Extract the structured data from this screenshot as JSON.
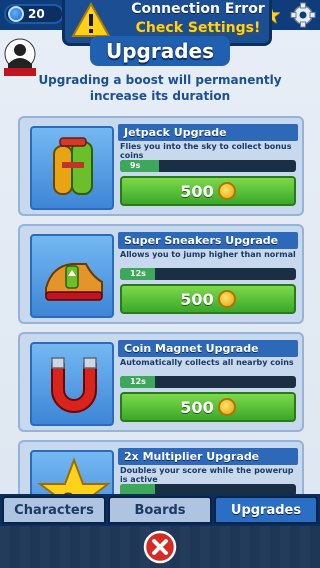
{
  "topbar": {
    "coins": "20"
  },
  "error_banner": {
    "title": "Connection Error",
    "subtitle": "Check Settings!"
  },
  "header": {
    "title": "Upgrades",
    "subtitle": "Upgrading a boost will permanently increase its duration"
  },
  "upgrades": [
    {
      "title": "Jetpack Upgrade",
      "description": "Flies you into the sky to collect bonus coins",
      "level_label": "9s",
      "level_fraction": 0.22,
      "price": "500",
      "icon": "jetpack-icon"
    },
    {
      "title": "Super Sneakers Upgrade",
      "description": "Allows you to jump higher than normal",
      "level_label": "12s",
      "level_fraction": 0.2,
      "price": "500",
      "icon": "sneakers-icon"
    },
    {
      "title": "Coin Magnet Upgrade",
      "description": "Automatically collects all nearby coins",
      "level_label": "12s",
      "level_fraction": 0.2,
      "price": "500",
      "icon": "magnet-icon"
    },
    {
      "title": "2x Multiplier Upgrade",
      "description": "Doubles your score while the powerup is active",
      "level_label": "",
      "level_fraction": 0.2,
      "price": "",
      "icon": "star-2x-icon"
    }
  ],
  "tabs": [
    {
      "label": "Characters",
      "active": false
    },
    {
      "label": "Boards",
      "active": false
    },
    {
      "label": "Upgrades",
      "active": true
    }
  ],
  "colors": {
    "button_green": "#3aa82a",
    "tab_active": "#2a6fc4",
    "accent_gold": "#ffd21a"
  }
}
